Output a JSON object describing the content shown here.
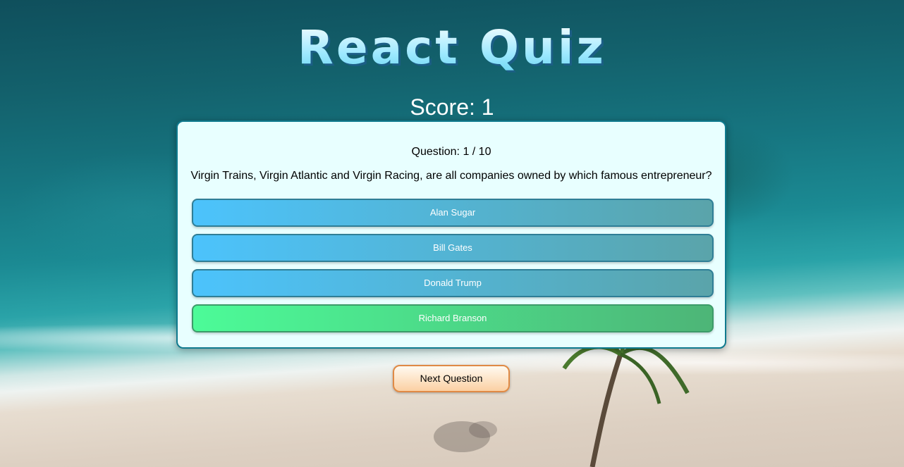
{
  "app": {
    "title": "React Quiz"
  },
  "score": {
    "text": "Score: 1"
  },
  "question": {
    "counter": "Question: 1 / 10",
    "text": "Virgin Trains, Virgin Atlantic and Virgin Racing, are all companies owned by which famous entrepreneur?"
  },
  "answers": [
    {
      "label": "Alan Sugar",
      "state": "default"
    },
    {
      "label": "Bill Gates",
      "state": "default"
    },
    {
      "label": "Donald Trump",
      "state": "default"
    },
    {
      "label": "Richard Branson",
      "state": "correct"
    }
  ],
  "next_button": {
    "label": "Next Question"
  },
  "colors": {
    "answer_gradient_start": "#4cc3fc",
    "answer_gradient_end": "#5aa4aa",
    "correct_gradient_start": "#4cfb98",
    "correct_gradient_end": "#4db577",
    "card_background": "#e8ffff",
    "card_border": "#0f7a8e",
    "next_button_border": "#e08a45"
  }
}
